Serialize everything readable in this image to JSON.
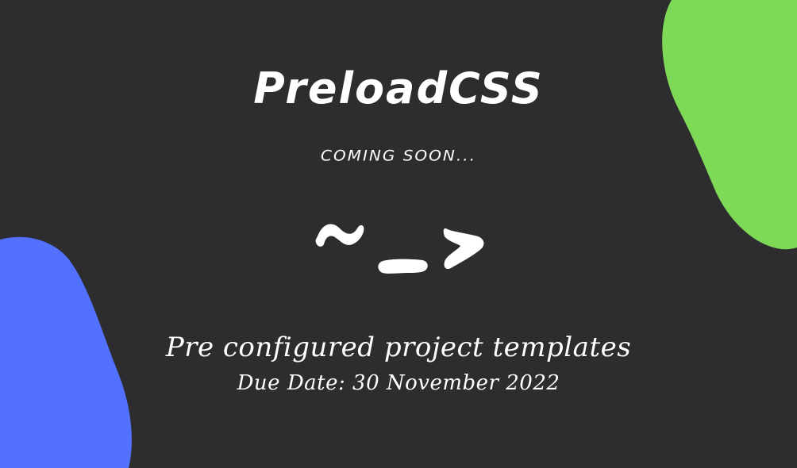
{
  "title": "PreloadCSS",
  "subtitle": "COMING SOON...",
  "tagline": "Pre configured project templates",
  "due_date": "Due Date: 30 November 2022",
  "logo": {
    "icon": "tilde-underscore-chevron-icon"
  },
  "colors": {
    "background": "#2d2d2f",
    "green_blob": "#7ed957",
    "blue_blob": "#5271ff",
    "text": "#ffffff"
  }
}
